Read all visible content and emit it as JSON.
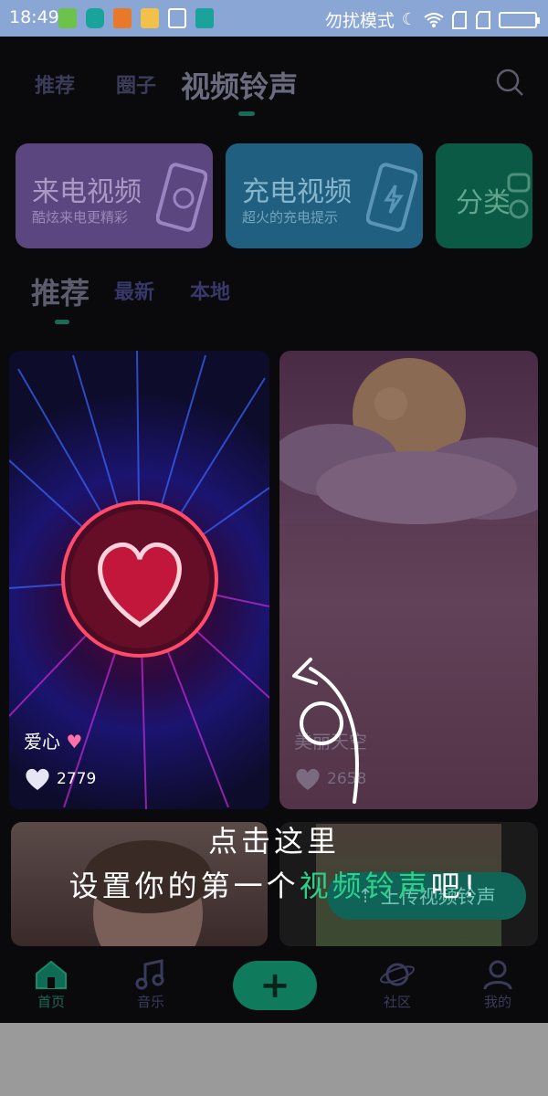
{
  "status_bar": {
    "time": "18:49",
    "right_text": "勿扰模式"
  },
  "top_tabs": [
    {
      "label": "推荐"
    },
    {
      "label": "圈子"
    },
    {
      "label": "视频铃声"
    }
  ],
  "categories": [
    {
      "title": "来电视频",
      "subtitle": "酷炫来电更精彩",
      "color": "#7e5ba8"
    },
    {
      "title": "充电视频",
      "subtitle": "超火的充电提示",
      "color": "#2a86b6"
    },
    {
      "title": "分类",
      "color": "#0f7a5c"
    }
  ],
  "sub_tabs": [
    {
      "label": "推荐"
    },
    {
      "label": "最新"
    },
    {
      "label": "本地"
    }
  ],
  "videos": [
    {
      "title": "爱心",
      "likes": "2779"
    },
    {
      "title": "美丽天空",
      "likes": "2658"
    }
  ],
  "upload_button": "上传视频铃声",
  "guide": {
    "line1": "点击这里",
    "line2_prefix": "设置你的第一个",
    "line2_highlight": "视频铃声",
    "line2_suffix": "吧!"
  },
  "bottom_nav": [
    {
      "label": "首页"
    },
    {
      "label": "音乐"
    },
    {
      "label": "社区"
    },
    {
      "label": "我的"
    }
  ]
}
